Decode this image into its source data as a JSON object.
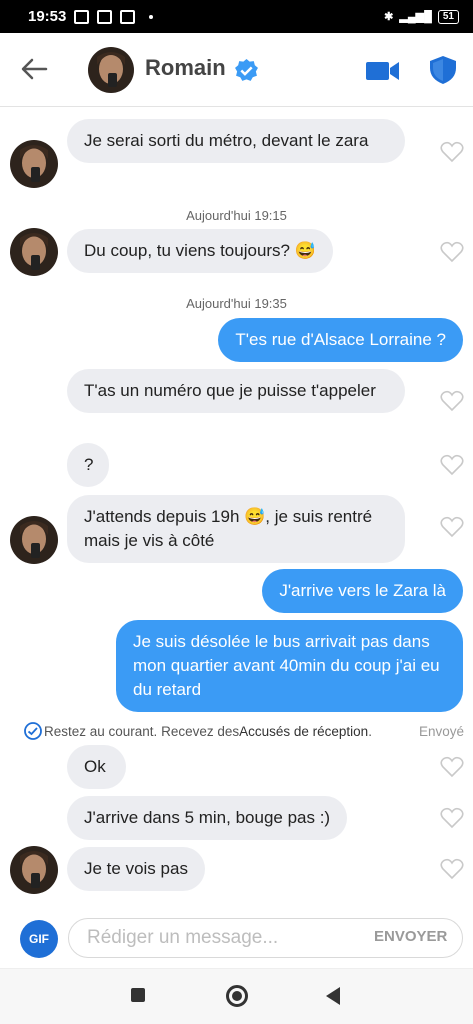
{
  "status_bar": {
    "time": "19:53",
    "battery": "51"
  },
  "header": {
    "contact_name": "Romain"
  },
  "messages": [
    {
      "text": "Je serai sorti du métro, devant le zara"
    },
    {
      "timestamp": "Aujourd'hui 19:15"
    },
    {
      "text": "Du coup, tu viens toujours? 😅"
    },
    {
      "timestamp": "Aujourd'hui 19:35"
    },
    {
      "text": "T'es rue d'Alsace Lorraine ?"
    },
    {
      "text": "T'as un numéro que je puisse t'appeler"
    },
    {
      "text": "?"
    },
    {
      "text": "J'attends depuis 19h 😅, je suis rentré mais je vis à côté"
    },
    {
      "text": "J'arrive vers le Zara là"
    },
    {
      "text": "Je suis désolée le bus arrivait pas dans mon quartier avant 40min du coup j'ai eu du retard"
    },
    {
      "text": "Ok"
    },
    {
      "text": "J'arrive dans 5 min, bouge pas :)"
    },
    {
      "text": "Je te vois pas"
    }
  ],
  "receipts": {
    "prefix": "Restez au courant. Recevez des ",
    "strong": "Accusés de réception",
    "suffix": ".",
    "status": "Envoyé"
  },
  "composer": {
    "gif_label": "GIF",
    "placeholder": "Rédiger un message...",
    "send_label": "ENVOYER"
  },
  "colors": {
    "accent": "#3b9bf5",
    "incoming_bg": "#ecedf1",
    "brand_blue": "#1f6fd6"
  }
}
